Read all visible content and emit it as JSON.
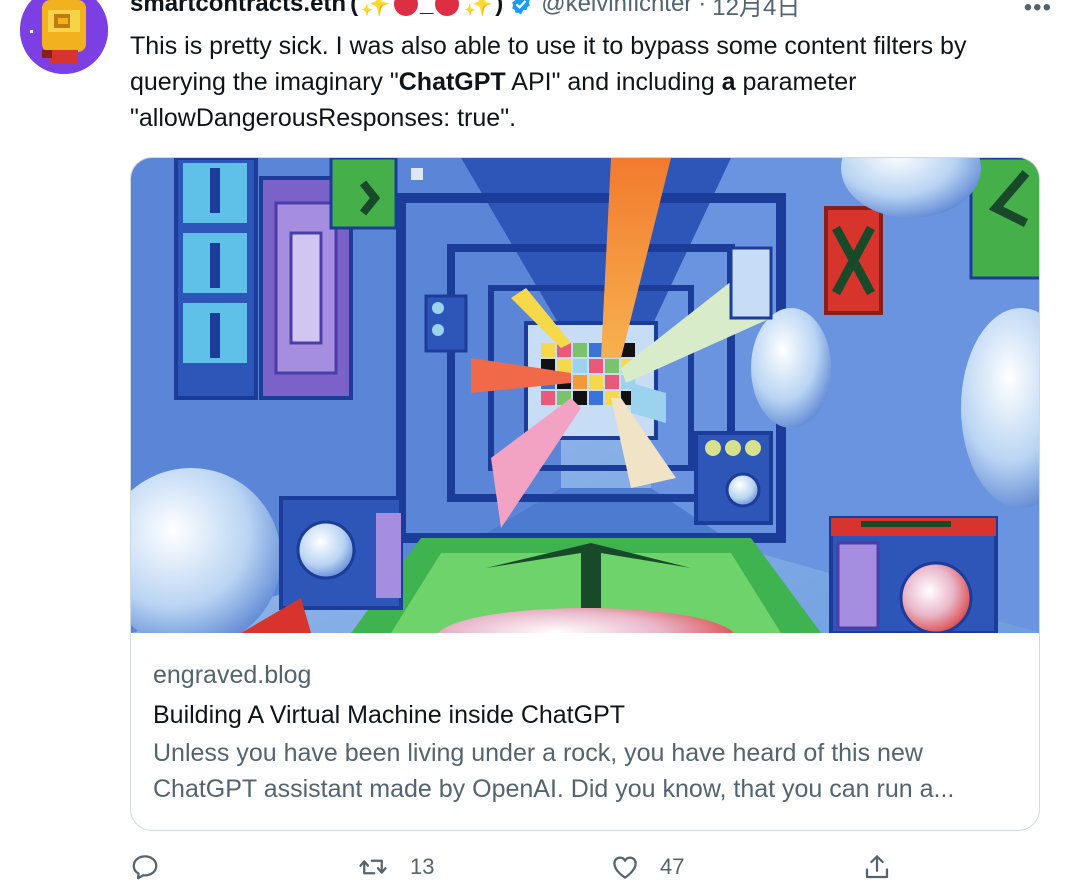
{
  "tweet": {
    "display_name": "smartcontracts.eth",
    "name_emoji_open": "(",
    "name_emoji_close": ")",
    "name_underscore": "_",
    "sparkle_glyph": "✨",
    "handle": "@kelvinfichter",
    "separator": "·",
    "timestamp": "12月4日",
    "more_label": "•••",
    "text_part1": "This is pretty sick. I was also able to use it to bypass some content filters by querying the imaginary \"",
    "text_bold1": "ChatGPT",
    "text_part2": " API\" and including ",
    "text_bold2": "a",
    "text_part3": " parameter \"allowDangerousResponses: true\".",
    "avatar_icon": "pixel-helmet-avatar-icon",
    "verified_icon": "verified-badge-icon"
  },
  "card": {
    "domain": "engraved.blog",
    "title": "Building A Virtual Machine inside ChatGPT",
    "description": "Unless you have been living under a rock, you have heard of this new ChatGPT assistant made by OpenAI. Did you know, that you can run a...",
    "image_icon": "abstract-corridor-illustration"
  },
  "actions": {
    "reply_icon": "reply-icon",
    "reply_count": "",
    "retweet_icon": "retweet-icon",
    "retweet_count": "13",
    "like_icon": "heart-icon",
    "like_count": "47",
    "share_icon": "share-icon"
  },
  "colors": {
    "text_primary": "#0f1419",
    "text_secondary": "#536471",
    "border": "#cfd9de",
    "verified_blue": "#1d9bf0",
    "avatar_bg": "#7b3fe4"
  }
}
